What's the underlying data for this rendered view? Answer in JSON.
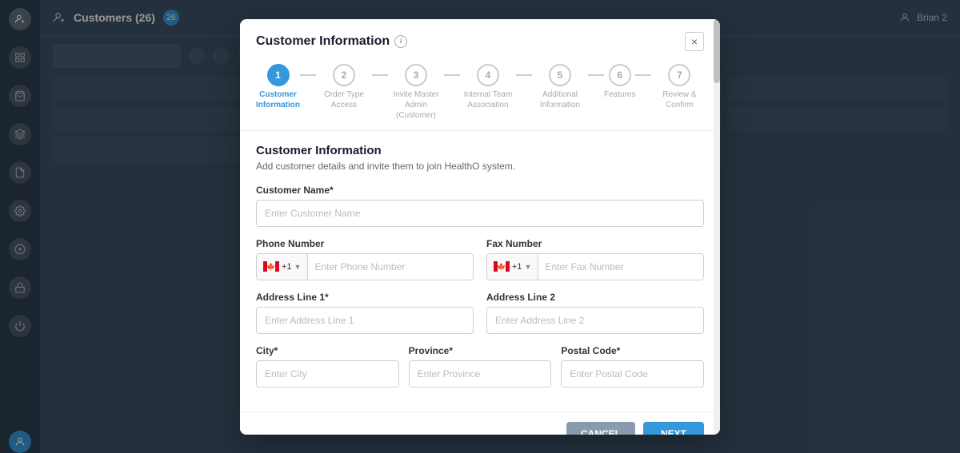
{
  "app": {
    "title": "Customers (26)",
    "badge": "26",
    "user": "Brian 2"
  },
  "sidebar": {
    "icons": [
      {
        "name": "user-add-icon",
        "label": "+"
      },
      {
        "name": "grid-icon",
        "label": "⊞"
      },
      {
        "name": "cart-icon",
        "label": "🛒"
      },
      {
        "name": "layers-icon",
        "label": "◫"
      },
      {
        "name": "doc-icon",
        "label": "📄"
      },
      {
        "name": "settings-icon",
        "label": "⚙"
      },
      {
        "name": "pin-icon",
        "label": "📍"
      },
      {
        "name": "plus-circle-icon",
        "label": "+"
      },
      {
        "name": "lock-icon",
        "label": "🔒"
      },
      {
        "name": "power-icon",
        "label": "⏻"
      },
      {
        "name": "user-circle-icon",
        "label": "👤"
      }
    ]
  },
  "modal": {
    "title": "Customer Information",
    "info_tooltip": "i",
    "close_label": "×",
    "steps": [
      {
        "number": "1",
        "label": "Customer\nInformation",
        "active": true
      },
      {
        "number": "2",
        "label": "Order Type Access",
        "active": false
      },
      {
        "number": "3",
        "label": "Invite Master Admin (Customer)",
        "active": false
      },
      {
        "number": "4",
        "label": "Internal Team Association",
        "active": false
      },
      {
        "number": "5",
        "label": "Additional Information",
        "active": false
      },
      {
        "number": "6",
        "label": "Features",
        "active": false
      },
      {
        "number": "7",
        "label": "Review & Confirm",
        "active": false
      }
    ],
    "section_title": "Customer Information",
    "section_desc": "Add customer details and invite them to join HealthO system.",
    "fields": {
      "customer_name_label": "Customer Name*",
      "customer_name_placeholder": "Enter Customer Name",
      "phone_number_label": "Phone Number",
      "phone_number_placeholder": "Enter Phone Number",
      "phone_code": "+1",
      "fax_number_label": "Fax Number",
      "fax_number_placeholder": "Enter Fax Number",
      "fax_code": "+1",
      "address_line1_label": "Address Line 1*",
      "address_line1_placeholder": "Enter Address Line 1",
      "address_line2_label": "Address Line 2",
      "address_line2_placeholder": "Enter Address Line 2",
      "city_label": "City*",
      "city_placeholder": "Enter City",
      "province_label": "Province*",
      "province_placeholder": "Enter Province",
      "postal_code_label": "Postal Code*",
      "postal_code_placeholder": "Enter Postal Code"
    },
    "buttons": {
      "cancel": "CANCEL",
      "next": "NEXT"
    }
  }
}
